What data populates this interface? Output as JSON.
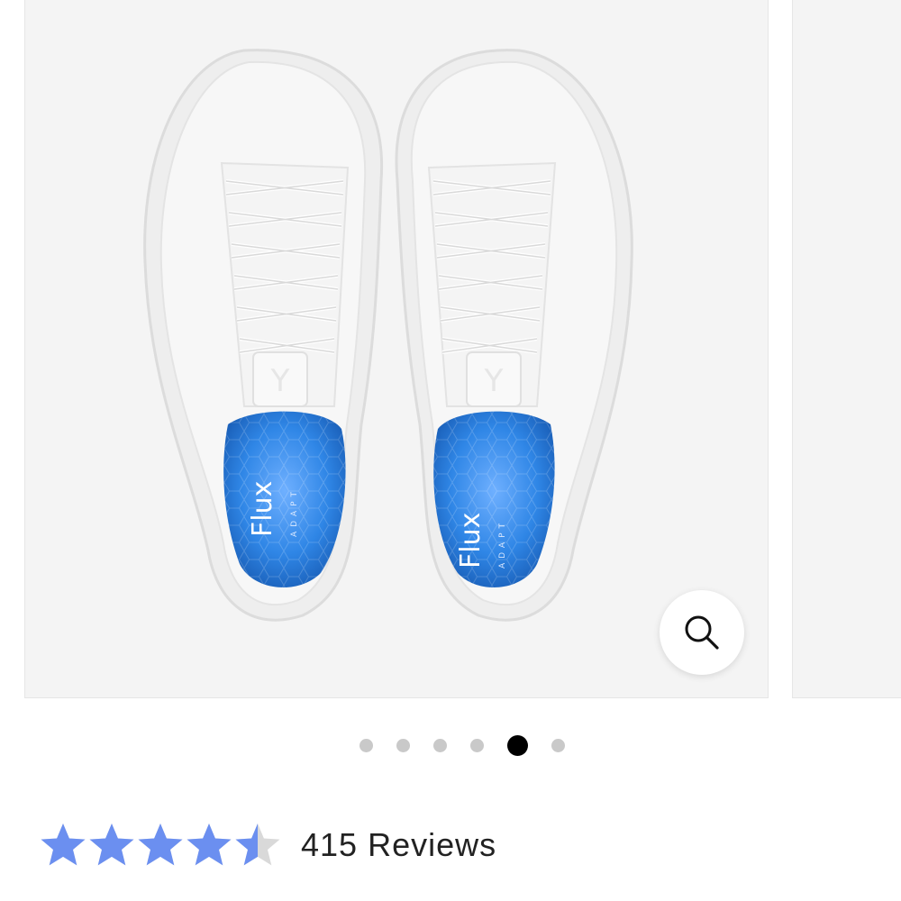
{
  "product": {
    "image_alt": "White knit sneakers, top view",
    "insole_brand": "Flux",
    "insole_sub": "ADAPT",
    "zoom_icon": "magnifier-icon"
  },
  "carousel": {
    "total_slides": 6,
    "active_index": 4
  },
  "rating": {
    "value": 4.5,
    "max": 5,
    "star_color": "#6b8ff0",
    "empty_color": "#d9d9d9",
    "reviews_label": "415 Reviews"
  }
}
